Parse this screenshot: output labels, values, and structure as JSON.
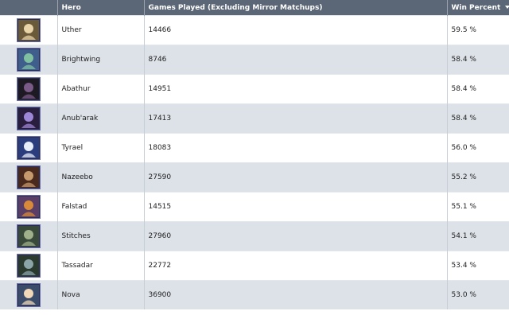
{
  "table": {
    "headers": {
      "icon": "",
      "hero": "Hero",
      "games": "Games Played (Excluding Mirror Matchups)",
      "win": "Win Percent"
    },
    "rows": [
      {
        "hero": "Uther",
        "games": "14466",
        "win": "59.5 %",
        "portrait_icon": "uther-portrait-icon",
        "colors": [
          "#6a5a3a",
          "#e9d3a8"
        ]
      },
      {
        "hero": "Brightwing",
        "games": "8746",
        "win": "58.4 %",
        "portrait_icon": "brightwing-portrait-icon",
        "colors": [
          "#3f5e8c",
          "#7fc0a0"
        ]
      },
      {
        "hero": "Abathur",
        "games": "14951",
        "win": "58.4 %",
        "portrait_icon": "abathur-portrait-icon",
        "colors": [
          "#1e1a24",
          "#7a5a86"
        ]
      },
      {
        "hero": "Anub'arak",
        "games": "17413",
        "win": "58.4 %",
        "portrait_icon": "anubarak-portrait-icon",
        "colors": [
          "#2a1e3e",
          "#9e86d6"
        ]
      },
      {
        "hero": "Tyrael",
        "games": "18083",
        "win": "56.0 %",
        "portrait_icon": "tyrael-portrait-icon",
        "colors": [
          "#2b3d7c",
          "#e8eef8"
        ]
      },
      {
        "hero": "Nazeebo",
        "games": "27590",
        "win": "55.2 %",
        "portrait_icon": "nazeebo-portrait-icon",
        "colors": [
          "#4a2a1c",
          "#c79a6e"
        ]
      },
      {
        "hero": "Falstad",
        "games": "14515",
        "win": "55.1 %",
        "portrait_icon": "falstad-portrait-icon",
        "colors": [
          "#5a3e66",
          "#d88a3a"
        ]
      },
      {
        "hero": "Stitches",
        "games": "27960",
        "win": "54.1 %",
        "portrait_icon": "stitches-portrait-icon",
        "colors": [
          "#3a4a3a",
          "#9fb08a"
        ]
      },
      {
        "hero": "Tassadar",
        "games": "22772",
        "win": "53.4 %",
        "portrait_icon": "tassadar-portrait-icon",
        "colors": [
          "#2a3a2e",
          "#8aa4a8"
        ]
      },
      {
        "hero": "Nova",
        "games": "36900",
        "win": "53.0 %",
        "portrait_icon": "nova-portrait-icon",
        "colors": [
          "#3b4c6a",
          "#f0d8b8"
        ]
      }
    ]
  }
}
